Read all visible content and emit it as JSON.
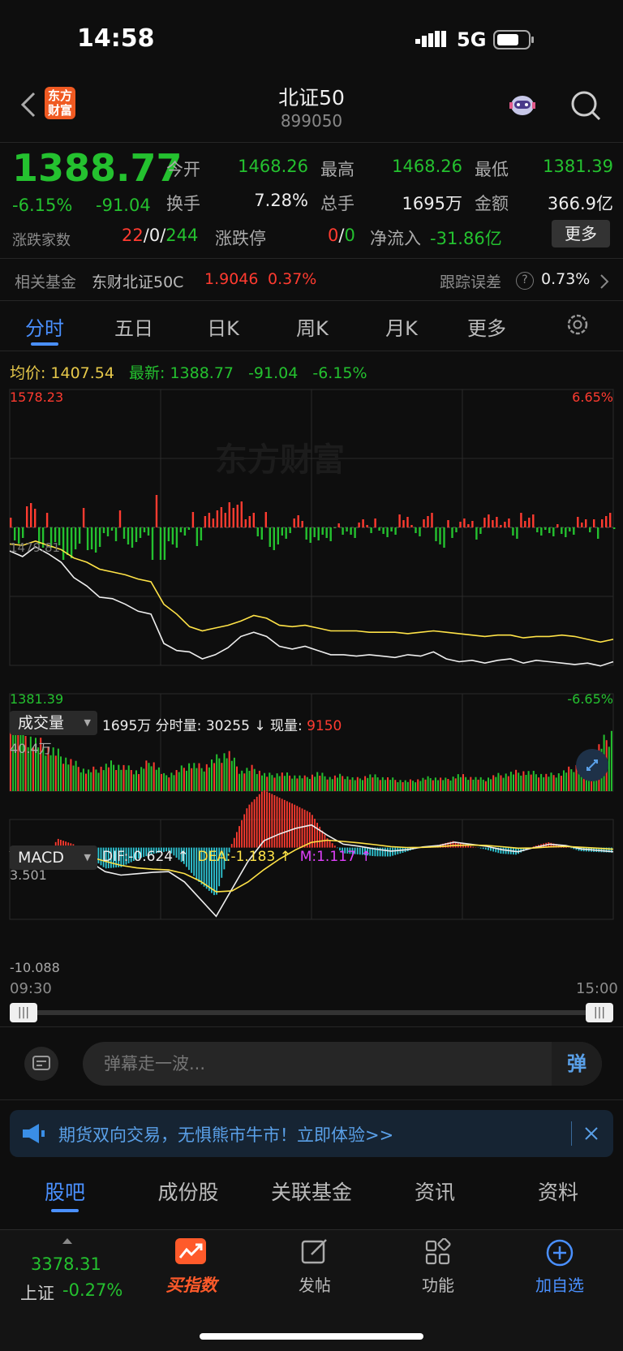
{
  "status_bar": {
    "time": "14:58",
    "network": "5G"
  },
  "header": {
    "title": "北证50",
    "code": "899050",
    "brand_logo": "东方财富"
  },
  "quote": {
    "price": "1388.77",
    "change_pct": "-6.15%",
    "change": "-91.04",
    "open_label": "今开",
    "open": "1468.26",
    "high_label": "最高",
    "high": "1468.26",
    "low_label": "最低",
    "low": "1381.39",
    "turnover_label": "换手",
    "turnover": "7.28%",
    "volume_label": "总手",
    "volume": "1695万",
    "amount_label": "金额",
    "amount": "366.9亿",
    "breadth_label": "涨跌家数",
    "breadth_up": "22",
    "breadth_flat": "0",
    "breadth_down": "244",
    "limit_label": "涨跌停",
    "limit_up": "0",
    "limit_down": "0",
    "netflow_label": "净流入",
    "netflow": "-31.86亿",
    "more_button": "更多"
  },
  "fund": {
    "label": "相关基金",
    "name": "东财北证50C",
    "price": "1.9046",
    "pct": "0.37%",
    "tracking_label": "跟踪误差",
    "tracking_value": "0.73%"
  },
  "chart_tabs": [
    "分时",
    "五日",
    "日K",
    "周K",
    "月K",
    "更多"
  ],
  "price_info": {
    "avg_label": "均价:",
    "avg": "1407.54",
    "latest_label": "最新:",
    "latest": "1388.77",
    "change": "-91.04",
    "pct": "-6.15%"
  },
  "chart_labels": {
    "top_price": "1578.23",
    "top_pct": "6.65%",
    "mid_price": "1479.81",
    "bottom_price": "1381.39",
    "bottom_pct": "-6.65%",
    "watermark": "东方财富",
    "vol_max": "40.4万",
    "macd_top": "3.501",
    "macd_bottom": "-10.088",
    "time_start": "09:30",
    "time_end": "15:00"
  },
  "volume_bar": {
    "selector": "成交量",
    "total": "1695万",
    "fen_label": "分时量:",
    "fen_value": "30255",
    "arrow": "↓",
    "now_label": "现量:",
    "now_value": "9150"
  },
  "macd_bar": {
    "selector": "MACD",
    "dif": "DIF:-0.624 ↑",
    "dea": "DEA:-1.183 ↑",
    "m": "M:1.117 ↑"
  },
  "comment": {
    "placeholder": "弹幕走一波...",
    "danmu_button": "弹"
  },
  "banner": {
    "text": "期货双向交易，无惧熊市牛市！立即体验>>"
  },
  "section_tabs": [
    "股吧",
    "成份股",
    "关联基金",
    "资讯",
    "资料"
  ],
  "bottom_bar": {
    "index_value": "3378.31",
    "index_name": "上证",
    "index_pct": "-0.27%",
    "buy": "买指数",
    "post": "发帖",
    "func": "功能",
    "add": "加自选"
  },
  "chart_data": {
    "type": "line",
    "x_range": [
      "09:30",
      "15:00"
    ],
    "ylim": [
      1381.39,
      1578.23
    ],
    "base": 1479.81,
    "series": [
      {
        "name": "price",
        "color": "#eeeeee",
        "values": [
          1463,
          1459,
          1466,
          1461,
          1455,
          1444,
          1438,
          1430,
          1429,
          1425,
          1420,
          1418,
          1397,
          1392,
          1391,
          1386,
          1389,
          1394,
          1402,
          1405,
          1402,
          1395,
          1393,
          1395,
          1392,
          1389,
          1389,
          1388,
          1389,
          1388,
          1387,
          1389,
          1388,
          1391,
          1386,
          1384,
          1385,
          1383,
          1385,
          1386,
          1383,
          1385,
          1384,
          1383,
          1382,
          1383,
          1381,
          1384
        ]
      },
      {
        "name": "avg",
        "color": "#ffe347",
        "values": [
          1468,
          1467,
          1470,
          1467,
          1464,
          1458,
          1455,
          1450,
          1448,
          1446,
          1443,
          1441,
          1425,
          1418,
          1409,
          1406,
          1408,
          1410,
          1413,
          1417,
          1415,
          1410,
          1409,
          1410,
          1408,
          1406,
          1406,
          1406,
          1405,
          1405,
          1405,
          1404,
          1405,
          1406,
          1405,
          1404,
          1403,
          1402,
          1403,
          1403,
          1401,
          1402,
          1402,
          1403,
          1402,
          1400,
          1398,
          1400
        ]
      }
    ],
    "volume": [
      40,
      30,
      25,
      22,
      18,
      14,
      10,
      12,
      14,
      12,
      10,
      16,
      8,
      10,
      14,
      12,
      16,
      20,
      10,
      12,
      8,
      9,
      8,
      7,
      9,
      7,
      8,
      6,
      8,
      7,
      6,
      5,
      6,
      7,
      6,
      8,
      7,
      6,
      8,
      9,
      10,
      9,
      8,
      9,
      12,
      16,
      22,
      30
    ],
    "macd_dif": [
      -0.5,
      -2,
      -2.5,
      -0.5,
      -0.8,
      -2,
      -3.5,
      -4,
      -3.8,
      -3.6,
      -3.5,
      -5,
      -7.5,
      -10,
      -6,
      -2,
      1,
      2,
      2.8,
      3.3,
      1.8,
      0.5,
      0.2,
      -0.2,
      -0.5,
      -0.3,
      0.1,
      0.3,
      0.8,
      0.5,
      0.2,
      -0.3,
      -0.6,
      0,
      0.5,
      0.3,
      -0.2,
      -0.4,
      -0.6
    ]
  }
}
